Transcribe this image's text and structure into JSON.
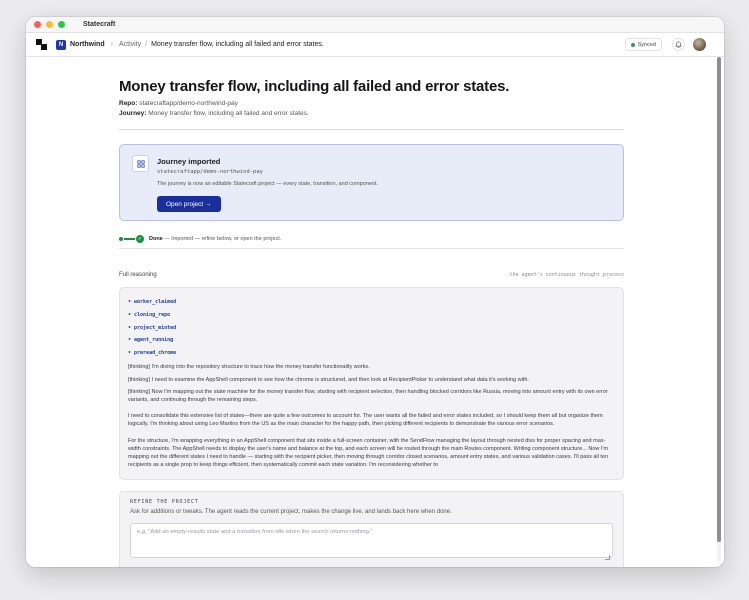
{
  "window": {
    "app_title": "Statecraft"
  },
  "appbar": {
    "workspace_initial": "N",
    "workspace_name": "Northwind",
    "breadcrumb_sep": "›",
    "breadcrumbs": [
      "Activity",
      "Money transfer flow, including all failed and error states."
    ],
    "breadcrumb_sep2": "/",
    "synced_label": "Synced"
  },
  "page": {
    "title": "Money transfer flow, including all failed and error states.",
    "repo_label": "Repo:",
    "repo_value": "statecraftapp/demo-northwind-pay",
    "journey_label": "Journey:",
    "journey_value": "Money transfer flow, including all failed and error states."
  },
  "imported": {
    "title": "Journey imported",
    "repo": "statecraftapp/demo-northwind-pay",
    "description": "The journey is now an editable Statecraft project — every state, transition, and component.",
    "button_label": "Open project →"
  },
  "progress": {
    "check": "✓",
    "done_label": "Done",
    "done_text": " — Imported — refine below, or open the project."
  },
  "reasoning": {
    "label": "Full reasoning",
    "hint": "the agent's continuous thought process",
    "steps": [
      "worker_claimed",
      "cloning_repo",
      "project_minted",
      "agent_running",
      "preread_chrome"
    ],
    "paragraphs": [
      "[thinking] I'm diving into the repository structure to trace how the money transfer functionality works.",
      "[thinking] I need to examine the AppShell component to see how the chrome is structured, and then look at RecipientPicker to understand what data it's working with.",
      "[thinking] Now I'm mapping out the state machine for the money transfer flow, starting with recipient selection, then handling blocked corridors like Russia, moving into amount entry with its own error variants, and continuing through the remaining steps.",
      "I need to consolidate this extensive list of states—there are quite a few outcomes to account for. The user wants all the failed and error states included, so I should keep them all but organize them logically. I'm thinking about using Leo Martins from the US as the main character for the happy path, then picking different recipients to demonstrate the various error scenarios.",
      "For the structure, I'm wrapping everything in an AppShell component that sits inside a full-screen container, with the SendFlow managing the layout through nested divs for proper spacing and max-width constraints. The AppShell needs to display the user's name and balance at the top, and each screen will be routed through the main Routes component. Writing component structure... Now I'm mapping out the different states I need to handle — starting with the recipient picker, then moving through corridor closed scenarios, amount entry states, and various validation cases. I'll pass all ten recipients as a single prop to keep things efficient, then systematically commit each state variation. I'm reconsidering whether to"
    ]
  },
  "refine": {
    "title": "REFINE THE PROJECT",
    "subtitle": "Ask for additions or tweaks. The agent reads the current project, makes the change live, and lands back here when done.",
    "placeholder": "e.g. \"Add an empty-results state and a transition from idle when the search returns nothing.\""
  }
}
